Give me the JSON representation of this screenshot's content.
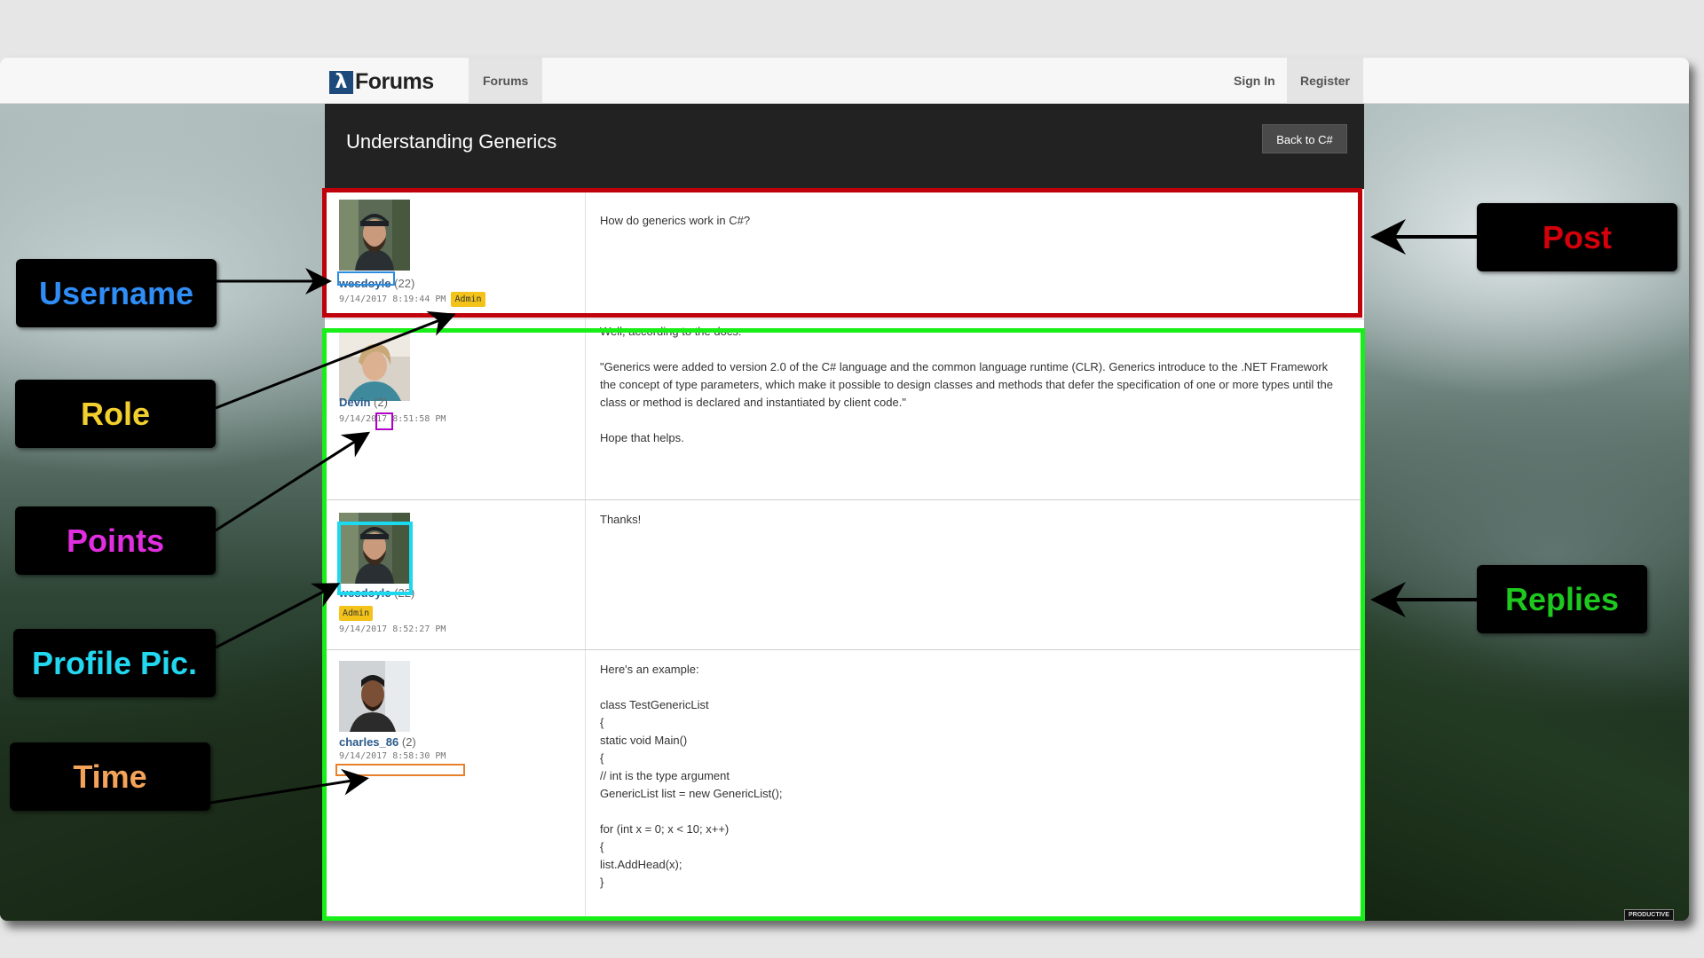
{
  "navbar": {
    "brand_mark": "λ",
    "brand_text": "Forums",
    "forums_link": "Forums",
    "sign_in": "Sign In",
    "register": "Register"
  },
  "thread": {
    "title": "Understanding Generics",
    "back_button": "Back to C#"
  },
  "posts": [
    {
      "username": "wesdoyle",
      "points": "(22)",
      "timestamp": "9/14/2017 8:19:44 PM",
      "role": "Admin",
      "body": "How do generics work in C#?"
    },
    {
      "username": "Devin",
      "points": "(2)",
      "timestamp": "9/14/2017 8:51:58 PM",
      "body": "Well, according to the docs:\n\n\"Generics were added to version 2.0 of the C# language and the common language runtime (CLR). Generics introduce to the .NET Framework the concept of type parameters, which make it possible to design classes and methods that defer the specification of one or more types until the class or method is declared and instantiated by client code.\"\n\nHope that helps."
    },
    {
      "username": "wesdoyle",
      "points": "(22)",
      "role": "Admin",
      "timestamp": "9/14/2017 8:52:27 PM",
      "body": "Thanks!"
    },
    {
      "username": "charles_86",
      "points": "(2)",
      "timestamp": "9/14/2017 8:58:30 PM",
      "body": "Here's an example:\n\nclass TestGenericList\n{\nstatic void Main()\n{\n// int is the type argument\nGenericList list = new GenericList();\n\nfor (int x = 0; x < 10; x++)\n{\nlist.AddHead(x);\n}"
    }
  ],
  "annotations": {
    "username": "Username",
    "role": "Role",
    "points": "Points",
    "profile_pic": "Profile Pic.",
    "time": "Time",
    "post": "Post",
    "replies": "Replies"
  },
  "colors": {
    "post_highlight": "#c0000a",
    "replies_highlight": "#18ef18",
    "username": "#2f8df6",
    "role": "#f2cf2e",
    "points": "#e02ee0",
    "profile_pic": "#22d8f0",
    "time": "#f3a35a"
  },
  "watermark": "PRODUCTIVE"
}
